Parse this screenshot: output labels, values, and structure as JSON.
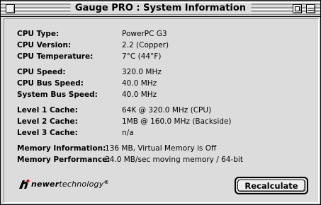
{
  "window": {
    "title": "Gauge PRO : System Information"
  },
  "info": [
    {
      "label": "CPU Type:",
      "value": "PowerPC G3"
    },
    {
      "label": "CPU Version:",
      "value": "2.2 (Copper)"
    },
    {
      "label": "CPU Temperature:",
      "value": "7°C (44°F)"
    },
    {
      "label": "CPU Speed:",
      "value": "320.0 MHz"
    },
    {
      "label": "CPU Bus Speed:",
      "value": "40.0 MHz"
    },
    {
      "label": "System Bus Speed:",
      "value": "40.0 MHz"
    },
    {
      "label": "Level 1 Cache:",
      "value": "64K @ 320.0 MHz (CPU)"
    },
    {
      "label": "Level 2 Cache:",
      "value": "1MB @ 160.0 MHz (Backside)"
    },
    {
      "label": "Level 3 Cache:",
      "value": "n/a"
    },
    {
      "label": "Memory Information:",
      "value": "136 MB, Virtual Memory is Off"
    },
    {
      "label": "Memory Performance:",
      "value": "34.0 MB/sec moving memory / 64-bit"
    }
  ],
  "logo": {
    "part1": "newer",
    "part2": "technology",
    "mark": "®",
    "icon": "nt-logo-icon"
  },
  "buttons": {
    "recalculate": "Recalculate"
  }
}
